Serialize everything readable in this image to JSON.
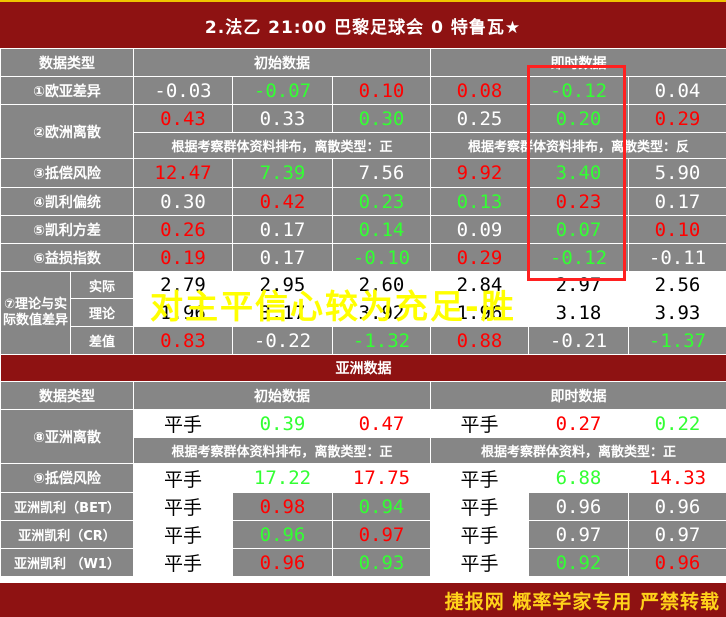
{
  "header": {
    "match_title": "2.法乙 21:00 巴黎足球会 0 特鲁瓦★"
  },
  "labels": {
    "data_type": "数据类型",
    "initial": "初始数据",
    "instant": "即时数据",
    "asia_section": "亚洲数据",
    "theory_label": "⑦理论与实际数值差异",
    "actual": "实际",
    "theory": "理论",
    "diff": "差值"
  },
  "rows": {
    "r1": {
      "label": "①欧亚差异",
      "values": [
        "-0.03",
        "-0.07",
        "0.10",
        "0.08",
        "-0.12",
        "0.04"
      ],
      "colors": [
        "white",
        "green",
        "red",
        "red",
        "green",
        "white"
      ]
    },
    "r2": {
      "label": "②欧洲离散",
      "values": [
        "0.43",
        "0.33",
        "0.30",
        "0.25",
        "0.20",
        "0.29"
      ],
      "colors": [
        "red",
        "white",
        "green",
        "white",
        "green",
        "red"
      ],
      "note_initial": "根据考察群体资料排布，离散类型：正",
      "note_instant": "根据考察群体资料排布，离散类型：反"
    },
    "r3": {
      "label": "③抵偿风险",
      "values": [
        "12.47",
        "7.39",
        "7.56",
        "9.92",
        "3.40",
        "5.90"
      ],
      "colors": [
        "red",
        "green",
        "white",
        "red",
        "green",
        "white"
      ]
    },
    "r4": {
      "label": "④凯利偏统",
      "values": [
        "0.30",
        "0.42",
        "0.23",
        "0.13",
        "0.23",
        "0.17"
      ],
      "colors": [
        "white",
        "red",
        "green",
        "green",
        "red",
        "white"
      ]
    },
    "r5": {
      "label": "⑤凯利方差",
      "values": [
        "0.26",
        "0.17",
        "0.14",
        "0.09",
        "0.07",
        "0.10"
      ],
      "colors": [
        "red",
        "white",
        "green",
        "white",
        "green",
        "red"
      ]
    },
    "r6": {
      "label": "⑥益损指数",
      "values": [
        "0.19",
        "0.17",
        "-0.10",
        "0.29",
        "-0.12",
        "-0.11"
      ],
      "colors": [
        "red",
        "white",
        "green",
        "red",
        "green",
        "white"
      ]
    },
    "actual": {
      "values": [
        "2.79",
        "2.95",
        "2.60",
        "2.84",
        "2.97",
        "2.56"
      ],
      "colors": [
        "black",
        "black",
        "black",
        "black",
        "black",
        "black"
      ]
    },
    "theory": {
      "values": [
        "1.96",
        "3.17",
        "3.92",
        "1.96",
        "3.18",
        "3.93"
      ],
      "colors": [
        "black",
        "black",
        "black",
        "black",
        "black",
        "black"
      ]
    },
    "diff": {
      "values": [
        "0.83",
        "-0.22",
        "-1.32",
        "0.88",
        "-0.21",
        "-1.37"
      ],
      "colors": [
        "red",
        "white",
        "green",
        "red",
        "white",
        "green"
      ]
    },
    "r8": {
      "label": "⑧亚洲离散",
      "values": [
        "平手",
        "0.39",
        "0.47",
        "平手",
        "0.27",
        "0.22"
      ],
      "colors": [
        "black",
        "green",
        "red",
        "black",
        "red",
        "green"
      ],
      "note_initial": "根据考察群体资料排布，离散类型：正",
      "note_instant": "根据考察群体资料，离散类型：正"
    },
    "r9": {
      "label": "⑨抵偿风险",
      "values": [
        "平手",
        "17.22",
        "17.75",
        "平手",
        "6.88",
        "14.33"
      ],
      "colors": [
        "black",
        "green",
        "red",
        "black",
        "green",
        "red"
      ]
    },
    "bet": {
      "label": "亚洲凯利（BET）",
      "values": [
        "平手",
        "0.98",
        "0.94",
        "平手",
        "0.96",
        "0.96"
      ],
      "colors": [
        "black",
        "red",
        "green",
        "black",
        "white",
        "white"
      ]
    },
    "cr": {
      "label": "亚洲凯利（CR）",
      "values": [
        "平手",
        "0.96",
        "0.97",
        "平手",
        "0.97",
        "0.97"
      ],
      "colors": [
        "black",
        "green",
        "red",
        "black",
        "white",
        "white"
      ]
    },
    "w1": {
      "label": "亚洲凯利 （W1）",
      "values": [
        "平手",
        "0.96",
        "0.93",
        "平手",
        "0.92",
        "0.96"
      ],
      "colors": [
        "black",
        "red",
        "green",
        "black",
        "green",
        "red"
      ]
    }
  },
  "overlay_text": "对主平信心较为充足-胜",
  "footer": {
    "text": "捷报网 概率学家专用 严禁转载"
  },
  "colors": {
    "title_bg": "#8e1212",
    "cell_bg": "#868686",
    "red": "#ff0000",
    "green": "#33ff33",
    "footer_text": "#ffd21a",
    "overlay_text": "#ffff00",
    "highlight_box": "#ff2020"
  }
}
